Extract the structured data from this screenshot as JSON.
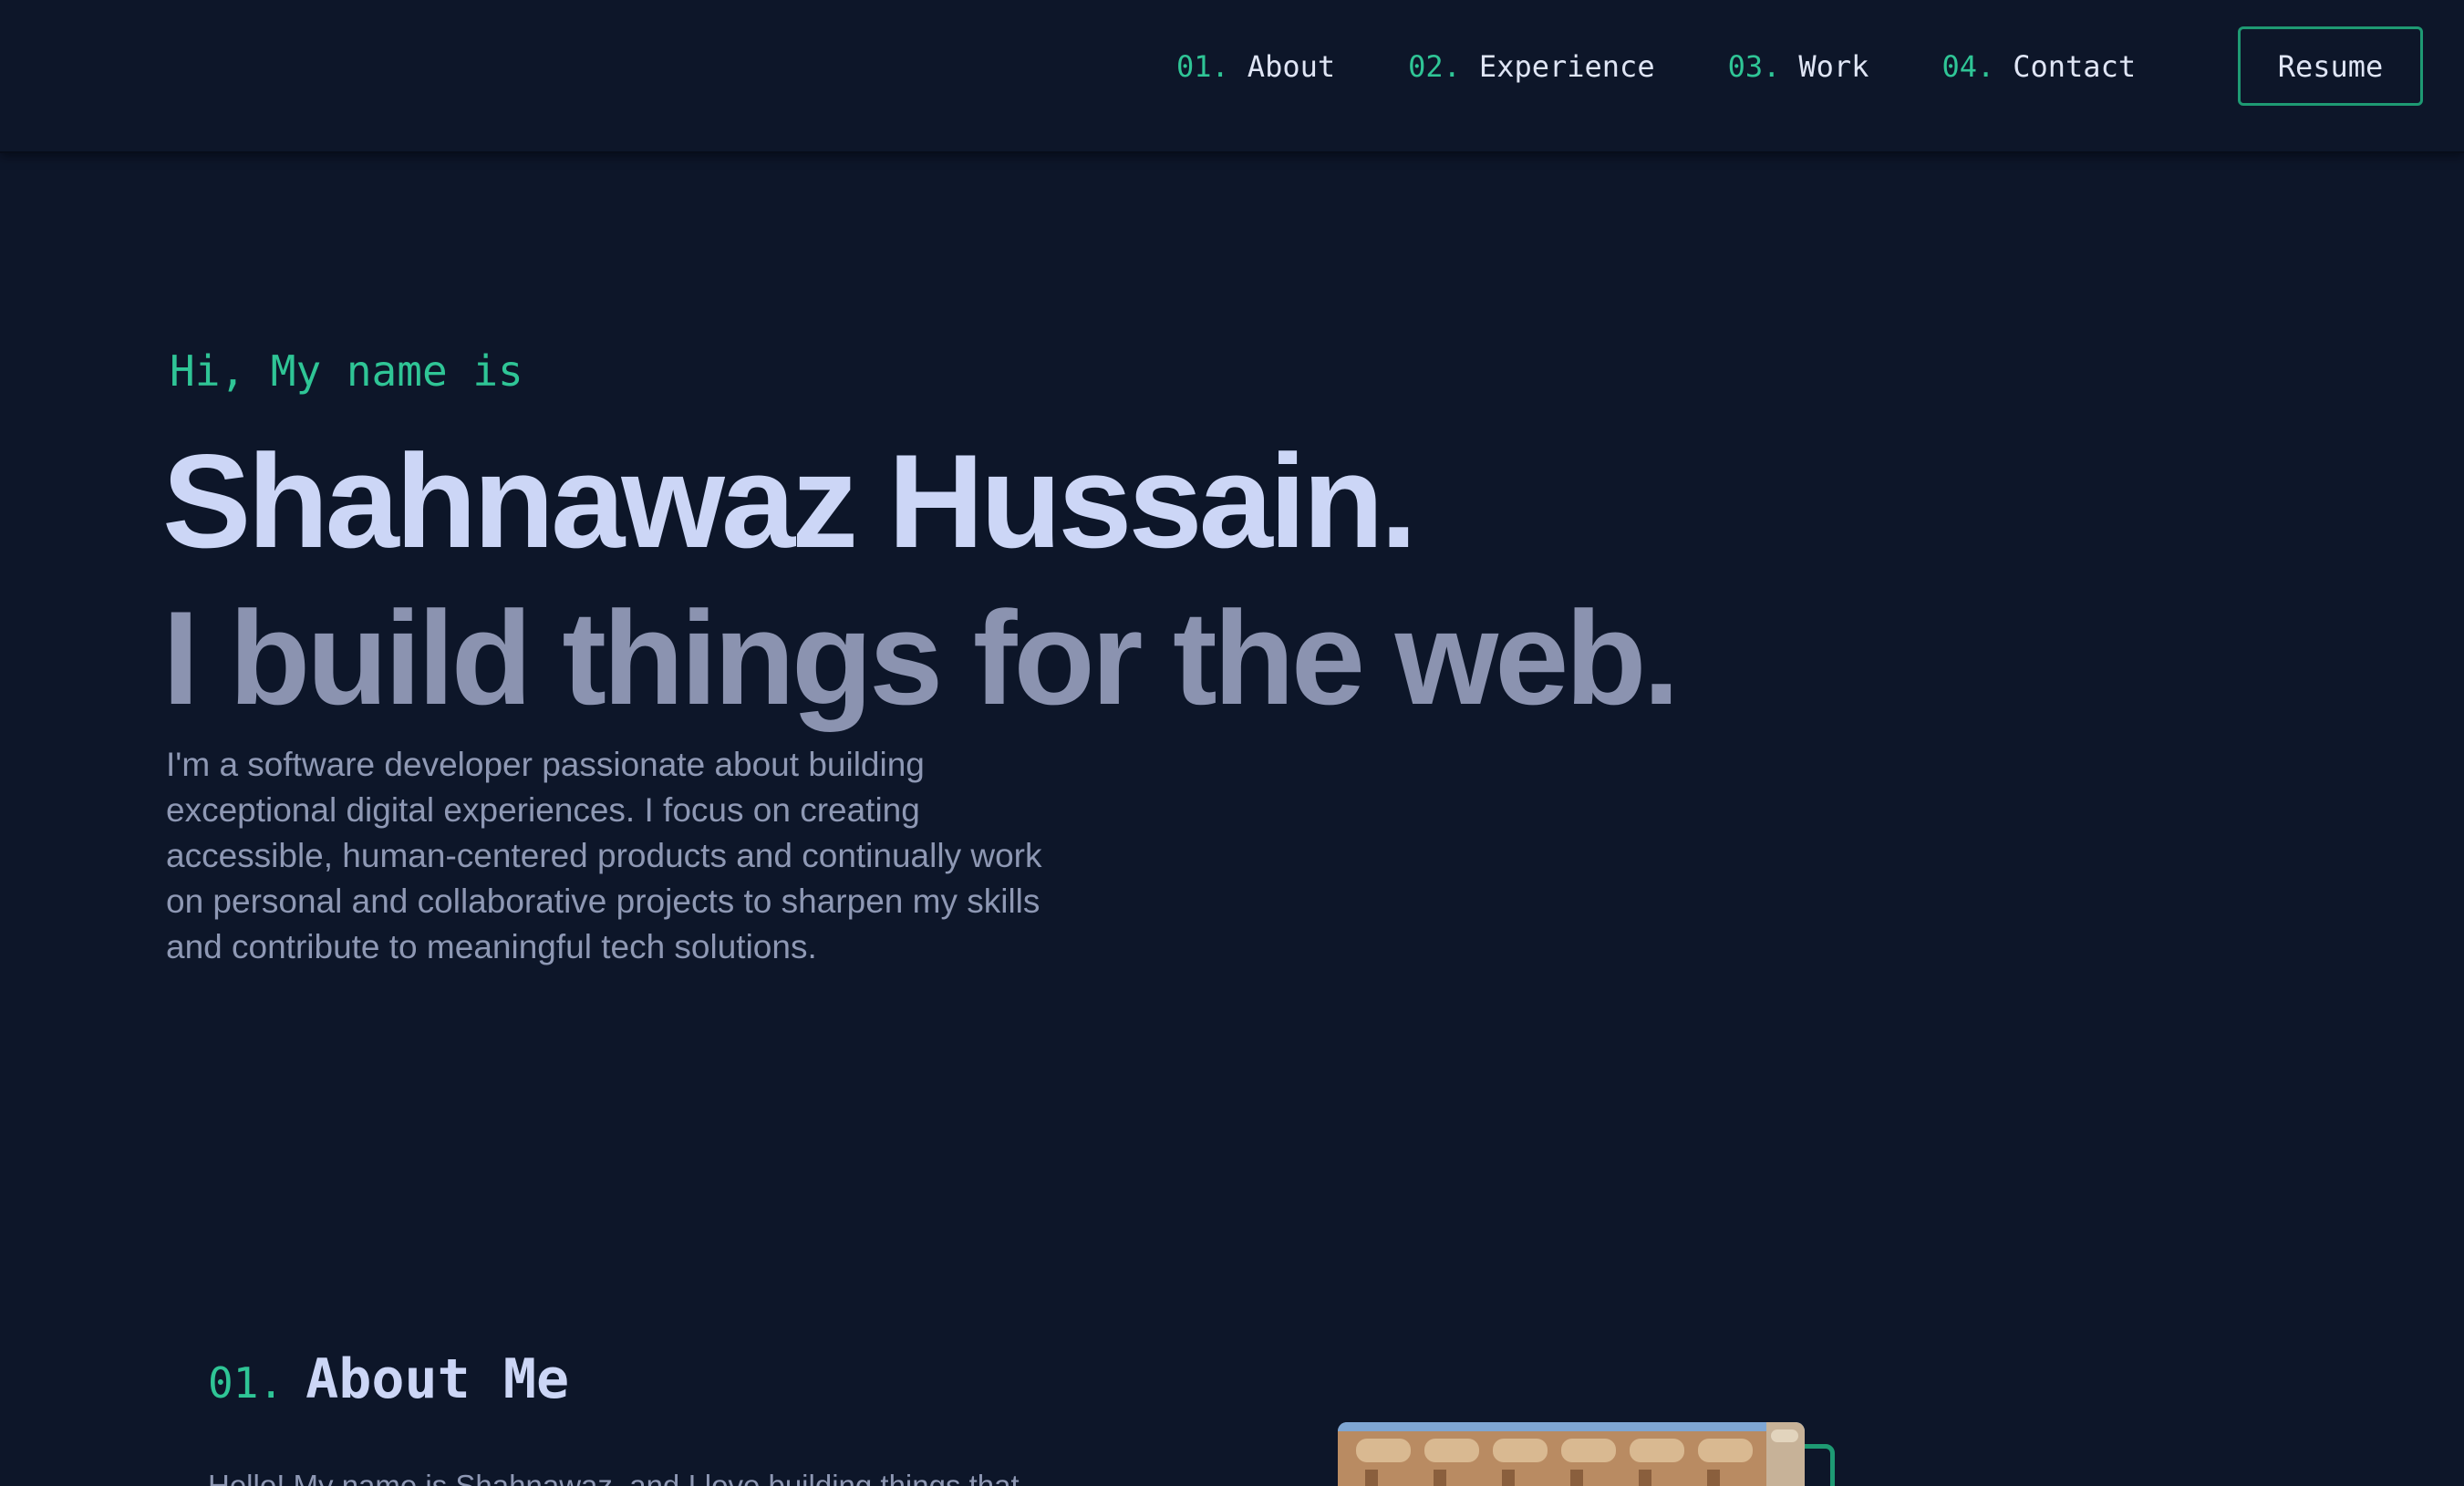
{
  "nav": {
    "items": [
      {
        "num": "01.",
        "label": "About"
      },
      {
        "num": "02.",
        "label": "Experience"
      },
      {
        "num": "03.",
        "label": "Work"
      },
      {
        "num": "04.",
        "label": "Contact"
      }
    ],
    "resume_label": "Resume"
  },
  "hero": {
    "greeting": "Hi, My name is",
    "name": "Shahnawaz Hussain.",
    "tagline": "I build things for the web.",
    "description": "I'm a software developer passionate about building exceptional digital experiences. I focus on creating accessible, human-centered products and continually work on personal and collaborative projects to sharpen my skills and contribute to meaningful tech solutions."
  },
  "about": {
    "num": "01.",
    "title": "About Me",
    "intro_visible": "Hello! My name is Shahnawaz, and I love building things that"
  },
  "colors": {
    "background": "#0d1629",
    "accent": "#2fc596",
    "heading": "#ccd6f6",
    "body_text": "#8e98b4",
    "tagline": "#8b93b0"
  }
}
